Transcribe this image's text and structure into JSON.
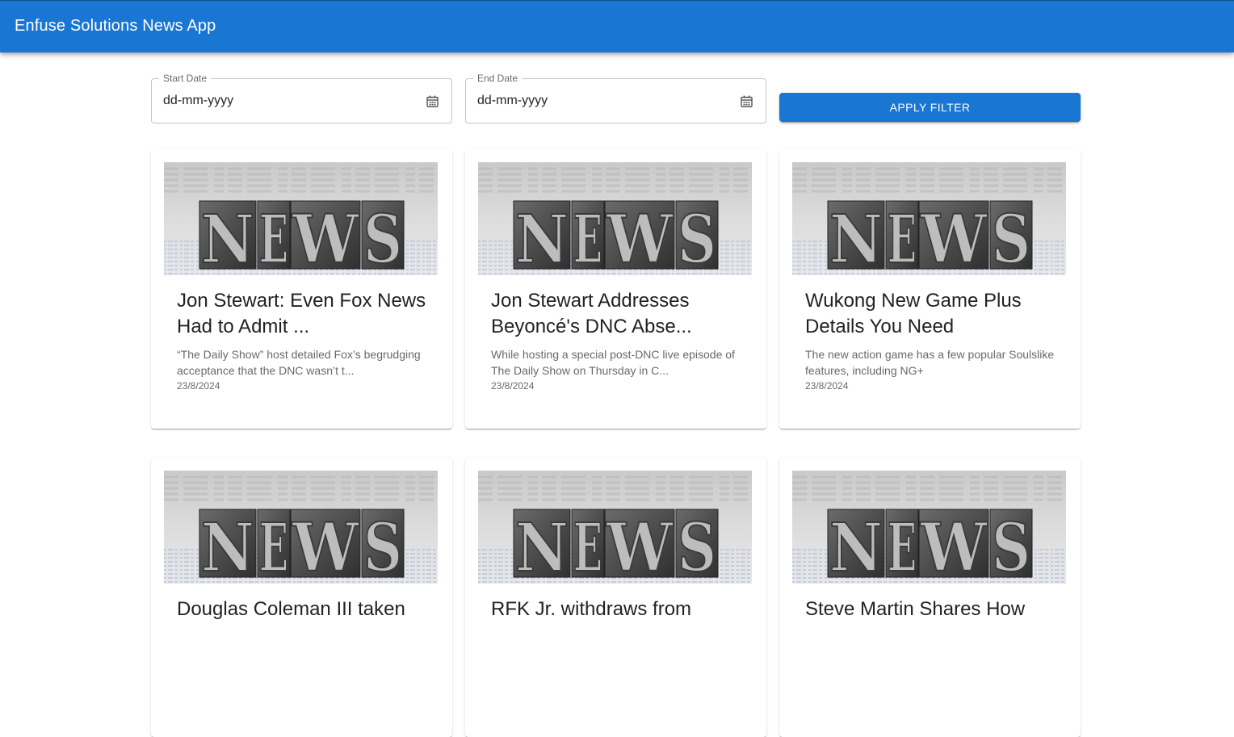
{
  "app": {
    "title": "Enfuse Solutions News App",
    "primary_color": "#1976d2"
  },
  "filters": {
    "start_date": {
      "label": "Start Date",
      "value": "dd-mm-yyyy",
      "icon": "calendar-icon"
    },
    "end_date": {
      "label": "End Date",
      "value": "dd-mm-yyyy",
      "icon": "calendar-icon"
    },
    "apply_label": "APPLY FILTER"
  },
  "cards": [
    {
      "image_text": "NEWS",
      "title": "Jon Stewart: Even Fox News Had to Admit ...",
      "description": "“The Daily Show” host detailed Fox’s begrudging acceptance that the DNC wasn’t t...",
      "date": "23/8/2024"
    },
    {
      "image_text": "NEWS",
      "title": "Jon Stewart Addresses Beyoncé's DNC Abse...",
      "description": "While hosting a special post-DNC live episode of The Daily Show on Thursday in C...",
      "date": "23/8/2024"
    },
    {
      "image_text": "NEWS",
      "title": "Wukong New Game Plus Details You Need",
      "description": "The new action game has a few popular Soulslike features, including NG+",
      "date": "23/8/2024"
    },
    {
      "image_text": "NEWS",
      "title": "Douglas Coleman III taken",
      "description": "",
      "date": ""
    },
    {
      "image_text": "NEWS",
      "title": "RFK Jr. withdraws from",
      "description": "",
      "date": ""
    },
    {
      "image_text": "NEWS",
      "title": "Steve Martin Shares How",
      "description": "",
      "date": ""
    }
  ]
}
